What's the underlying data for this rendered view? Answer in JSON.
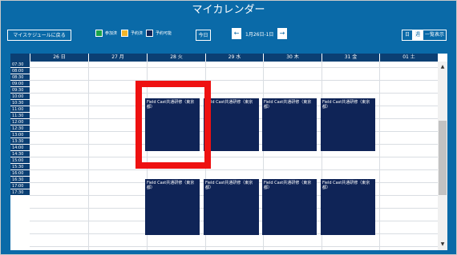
{
  "app": {
    "title": "マイカレンダー"
  },
  "toolbar": {
    "back_label": "マイスケジュールに戻る",
    "legend": [
      {
        "label": "参加済",
        "color": "#1aa34a"
      },
      {
        "label": "予約済",
        "color": "#f2b52a"
      },
      {
        "label": "予約可能",
        "color": "#0f2457"
      }
    ],
    "today_label": "今日",
    "prev_icon": "←",
    "next_icon": "→",
    "range_label": "1月26日-1日",
    "views": [
      "日",
      "週",
      "一覧表示"
    ],
    "active_view": "週"
  },
  "calendar": {
    "days": [
      "26 日",
      "27 月",
      "28 火",
      "29 水",
      "30 木",
      "31 金",
      "01 土"
    ],
    "times": [
      "07:30",
      "08:00",
      "08:30",
      "09:00",
      "09:30",
      "10:00",
      "10:30",
      "11:00",
      "11:30",
      "12:00",
      "12:30",
      "13:00",
      "13:30",
      "14:00",
      "14:30",
      "15:00",
      "15:30",
      "16:00",
      "16:30",
      "17:00",
      "17:30"
    ],
    "events": [
      {
        "title": "Field Cast共通研修（東京都）"
      },
      {
        "title": "Field Cast共通研修（東京都）"
      },
      {
        "title": "Field Cast共通研修（東京都）"
      },
      {
        "title": "Field Cast共通研修（東京都）"
      },
      {
        "title": "Field Cast共通研修（東京都）"
      },
      {
        "title": "Field Cast共通研修（東京都）"
      },
      {
        "title": "Field Cast共通研修（東京都）"
      },
      {
        "title": "Field Cast共通研修（東京都）"
      }
    ]
  },
  "scrollbar": {
    "up_icon": "▲",
    "down_icon": "▼"
  },
  "colors": {
    "accent": "#0a6aa8",
    "header": "#0b3f73",
    "event": "#0f2457",
    "highlight": "#ee1111"
  }
}
